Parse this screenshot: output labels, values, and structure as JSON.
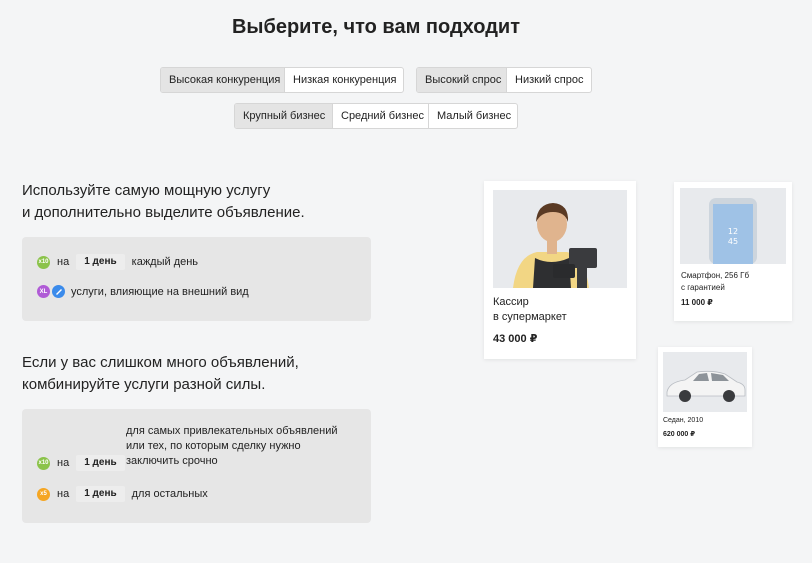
{
  "page": {
    "title": "Выберите, что вам подходит"
  },
  "filters": {
    "competition": [
      "Высокая конкуренция",
      "Низкая конкуренция"
    ],
    "competition_active": 0,
    "demand": [
      "Высокий спрос",
      "Низкий спрос"
    ],
    "demand_active": 0,
    "business": [
      "Крупный бизнес",
      "Средний бизнес",
      "Малый бизнес"
    ],
    "business_active": 0
  },
  "block1": {
    "heading_line1": "Используйте самую мощную услугу",
    "heading_line2": "и дополнительно выделите объявление.",
    "row1": {
      "badge": "x10",
      "on": "на",
      "duration": "1 день",
      "text": "каждый день"
    },
    "row2": {
      "badge1": "XL",
      "text": "услуги, влияющие на внешний вид"
    }
  },
  "block2": {
    "heading_line1": "Если у вас слишком много объявлений,",
    "heading_line2": "комбинируйте услуги разной силы.",
    "row1": {
      "badge": "x10",
      "on": "на",
      "duration": "1 день",
      "text_line1": "для самых привлекательных объявлений",
      "text_line2": "или тех, по которым сделку нужно",
      "text_line3": "заключить срочно"
    },
    "row2": {
      "badge": "x5",
      "on": "на",
      "duration": "1 день",
      "text": "для остальных"
    }
  },
  "cards": {
    "cashier": {
      "title_line1": "Кассир",
      "title_line2": "в супермаркет",
      "price": "43 000 ₽"
    },
    "phone": {
      "title_line1": "Смартфон, 256 Гб",
      "title_line2": "с гарантией",
      "price": "11 000 ₽"
    },
    "car": {
      "title_line1": "Седан, 2010",
      "price": "620 000 ₽"
    }
  },
  "colors": {
    "badge_green": "#8bc34a",
    "badge_orange": "#f5a623",
    "panel": "#e6e6e6",
    "active_seg": "#e4e4e4"
  }
}
